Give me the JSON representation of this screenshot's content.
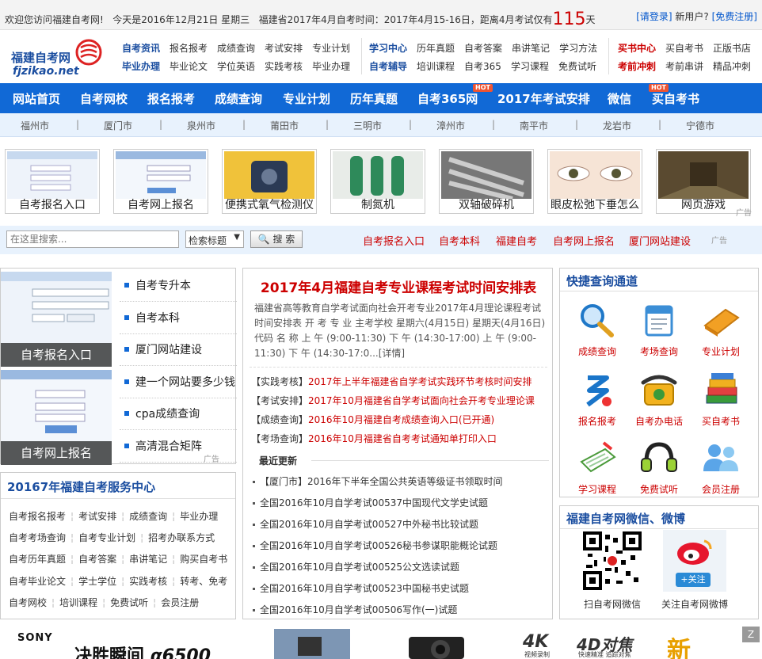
{
  "topbar": {
    "welcome": "欢迎您访问福建自考网!",
    "today_label": "今天是2016年12月21日 星期三",
    "exam_info": "福建省2017年4月自考时间：2017年4月15-16日，距离4月考试仅有",
    "days_left": "115",
    "days_unit": "天",
    "login": "[请登录]",
    "new_user": "新用户?",
    "register": "[免费注册]"
  },
  "logo": {
    "name": "福建自考网",
    "domain": "fjzikao.net"
  },
  "header": {
    "group1": {
      "row1": [
        "自考资讯",
        "报名报考",
        "成绩查询",
        "考试安排",
        "专业计划"
      ],
      "row2": [
        "毕业办理",
        "毕业论文",
        "学位英语",
        "实践考核",
        "毕业办理"
      ]
    },
    "group2": {
      "row1": [
        "学习中心",
        "历年真题",
        "自考答案",
        "串讲笔记",
        "学习方法"
      ],
      "row2": [
        "自考辅导",
        "培训课程",
        "自考365",
        "学习课程",
        "免费试听"
      ]
    },
    "group3": {
      "row1": [
        "买书中心",
        "买自考书",
        "正版书店"
      ],
      "row2": [
        "考前冲刺",
        "考前串讲",
        "精品冲刺"
      ]
    }
  },
  "nav": [
    "网站首页",
    "自考网校",
    "报名报考",
    "成绩查询",
    "专业计划",
    "历年真题",
    "自考365网",
    "2017年考试安排",
    "微信",
    "买自考书"
  ],
  "nav_hot": "HOT",
  "cities": [
    "福州市",
    "厦门市",
    "泉州市",
    "莆田市",
    "三明市",
    "漳州市",
    "南平市",
    "龙岩市",
    "宁德市"
  ],
  "city_sep": "|",
  "ads": [
    "自考报名入口",
    "自考网上报名",
    "便携式氧气检测仪",
    "制氮机",
    "双轴破碎机",
    "眼皮松弛下垂怎么",
    "网页游戏"
  ],
  "ad_tag": "广告",
  "search": {
    "placeholder": "在这里搜索...",
    "select": "检索标题",
    "button": "搜 索",
    "links": [
      "自考报名入口",
      "自考本科",
      "福建自考",
      "自考网上报名",
      "厦门网站建设"
    ]
  },
  "left_ad": {
    "pic_captions": [
      "自考报名入口",
      "自考网上报名"
    ],
    "list": [
      "自考专升本",
      "自考本科",
      "厦门网站建设",
      "建一个网站要多少钱",
      "cpa成绩查询",
      "高清混合矩阵"
    ]
  },
  "service": {
    "title": "20167年福建自考服务中心",
    "rows": [
      [
        "自考报名报考",
        "考试安排",
        "成绩查询",
        "毕业办理"
      ],
      [
        "自考考场查询",
        "自考专业计划",
        "招考办联系方式"
      ],
      [
        "自考历年真题",
        "自考答案",
        "串讲笔记",
        "购买自考书"
      ],
      [
        "自考毕业论文",
        "学士学位",
        "实践考核",
        "转考、免考"
      ],
      [
        "自考网校",
        "培训课程",
        "免费试听",
        "会员注册"
      ]
    ]
  },
  "main": {
    "title": "2017年4月福建自考专业课程考试时间安排表",
    "desc": "福建省高等教育自学考试面向社会开考专业2017年4月理论课程考试时间安排表 开 考 专 业 主考学校 星期六(4月15日) 星期天(4月16日) 代码 名 称 上 午 (9:00-11:30) 下 午 (14:30-17:00) 上 午 (9:00-11:30) 下 午 (14:30-17:0...[详情]",
    "news": [
      {
        "cat": "【实践考核】",
        "text": "2017年上半年福建省自学考试实践环节考核时间安排"
      },
      {
        "cat": "【考试安排】",
        "text": "2017年10月福建省自学考试面向社会开考专业理论课"
      },
      {
        "cat": "【成绩查询】",
        "text": "2016年10月福建自考成绩查询入口(已开通)"
      },
      {
        "cat": "【考场查询】",
        "text": "2016年10月福建省自考考试通知单打印入口"
      }
    ],
    "recent_title": "最近更新",
    "recent": [
      "【厦门市】2016年下半年全国公共英语等级证书领取时间",
      "全国2016年10月自学考试00537中国现代文学史试题",
      "全国2016年10月自学考试00527中外秘书比较试题",
      "全国2016年10月自学考试00526秘书参谋职能概论试题",
      "全国2016年10月自学考试00525公文选读试题",
      "全国2016年10月自学考试00523中国秘书史试题",
      "全国2016年10月自学考试00506写作(一)试题"
    ]
  },
  "quick": {
    "title": "快捷查询通道",
    "items": [
      {
        "label": "成绩查询",
        "icon": "magnifier-icon"
      },
      {
        "label": "考场查询",
        "icon": "calendar-icon"
      },
      {
        "label": "专业计划",
        "icon": "notebook-icon"
      },
      {
        "label": "报名报考",
        "icon": "logo-e-icon"
      },
      {
        "label": "自考办电话",
        "icon": "telephone-icon"
      },
      {
        "label": "买自考书",
        "icon": "books-icon"
      },
      {
        "label": "学习课程",
        "icon": "pen-paper-icon"
      },
      {
        "label": "免费试听",
        "icon": "headset-icon"
      },
      {
        "label": "会员注册",
        "icon": "users-icon"
      }
    ]
  },
  "wechat": {
    "title": "福建自考网微信、微博",
    "qr_caption": "扫自考网微信",
    "weibo_caption": "关注自考网微博",
    "follow": "+关注"
  },
  "bottom_ad": {
    "brand": "SONY",
    "slogan": "决胜瞬间",
    "model": "α6500",
    "feat1": "4K",
    "feat2": "4D对焦",
    "feat1_sub": "视频录制",
    "feat2_sub": "快速精准 追踪对焦",
    "new": "新"
  },
  "close_z": "Z"
}
